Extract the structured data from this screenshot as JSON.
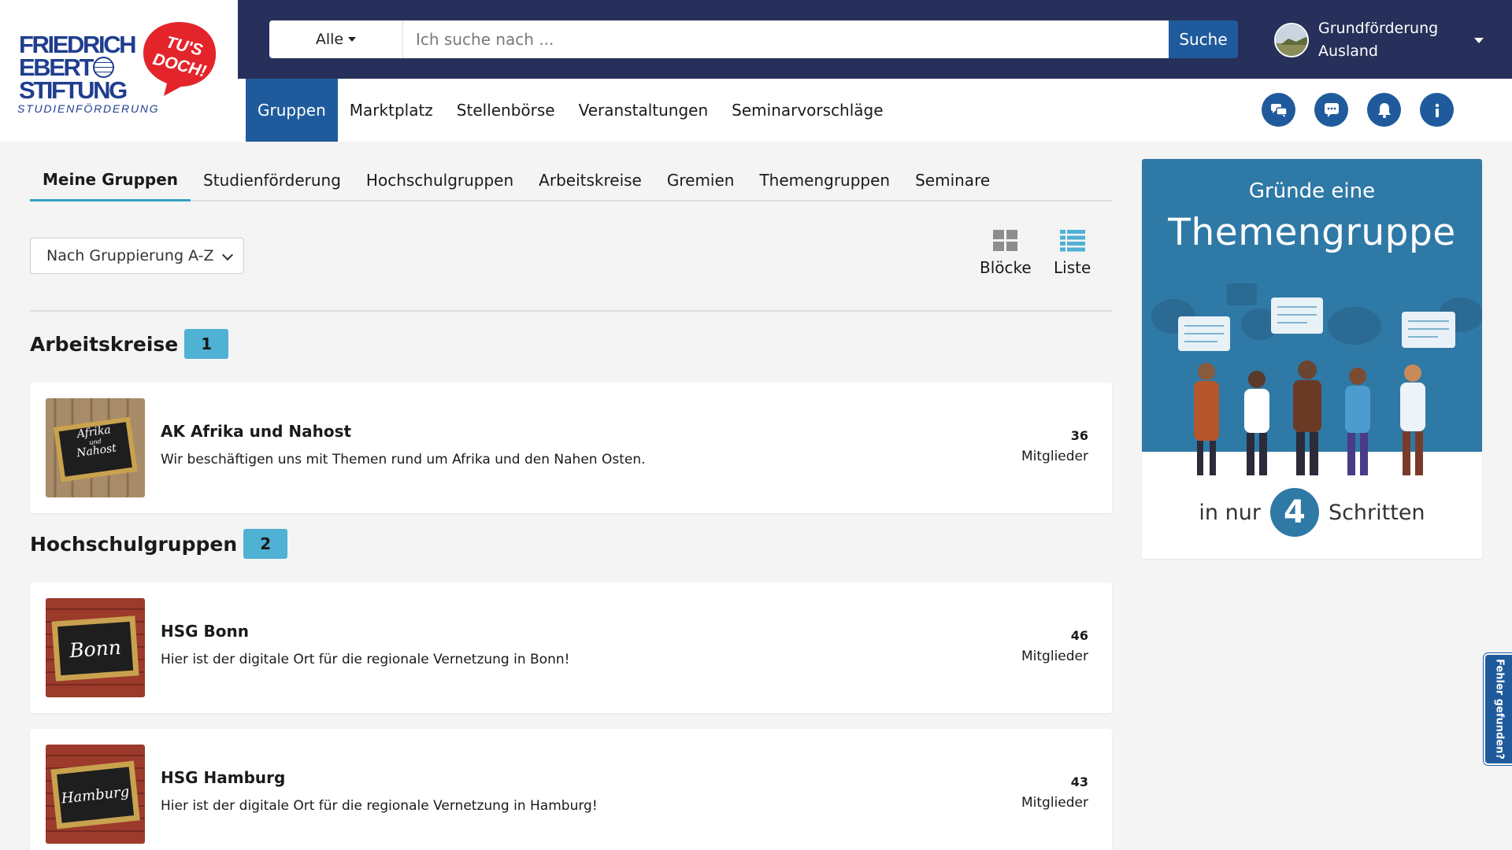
{
  "logo": {
    "lines": [
      "FRIEDRICH",
      "EBERT",
      "STIFTUNG"
    ],
    "subtitle": "STUDIENFÖRDERUNG",
    "bubble_lines": [
      "TU'S",
      "DOCH!"
    ],
    "brand_color": "#1f3e8f",
    "bubble_color": "#e3252b"
  },
  "search": {
    "category": "Alle",
    "placeholder": "Ich suche nach ...",
    "value": "",
    "button_label": "Suche"
  },
  "user": {
    "name_line1": "Grundförderung",
    "name_line2": "Ausland"
  },
  "nav": {
    "items": [
      {
        "label": "Gruppen",
        "active": true
      },
      {
        "label": "Marktplatz"
      },
      {
        "label": "Stellenbörse"
      },
      {
        "label": "Veranstaltungen"
      },
      {
        "label": "Seminarvorschläge"
      }
    ],
    "icons": [
      "chat-icon",
      "message-icon",
      "bell-icon",
      "info-icon"
    ]
  },
  "tabs": [
    {
      "label": "Meine Gruppen",
      "active": true
    },
    {
      "label": "Studienförderung"
    },
    {
      "label": "Hochschulgruppen"
    },
    {
      "label": "Arbeitskreise"
    },
    {
      "label": "Gremien"
    },
    {
      "label": "Themengruppen"
    },
    {
      "label": "Seminare"
    }
  ],
  "sort": {
    "selected": "Nach Gruppierung A-Z",
    "options": [
      "Nach Gruppierung A-Z"
    ]
  },
  "views": {
    "blocks_label": "Blöcke",
    "list_label": "Liste",
    "active": "list"
  },
  "sections": [
    {
      "title": "Arbeitskreise",
      "count": "1",
      "groups": [
        {
          "title": "AK Afrika und Nahost",
          "description": "Wir beschäftigen uns mit Themen rund um Afrika und den Nahen Osten.",
          "members": "36",
          "members_label": "Mitglieder",
          "board_lines": [
            "Afrika",
            "und",
            "Nahost"
          ],
          "bg": "wood"
        }
      ]
    },
    {
      "title": "Hochschulgruppen",
      "count": "2",
      "groups": [
        {
          "title": "HSG Bonn",
          "description": "Hier ist der digitale Ort für die regionale Vernetzung in Bonn!",
          "members": "46",
          "members_label": "Mitglieder",
          "board_lines": [
            "Bonn"
          ],
          "bg": "brick"
        },
        {
          "title": "HSG Hamburg",
          "description": "Hier ist der digitale Ort für die regionale Vernetzung in Hamburg!",
          "members": "43",
          "members_label": "Mitglieder",
          "board_lines": [
            "Hamburg"
          ],
          "bg": "brick"
        }
      ]
    }
  ],
  "promo": {
    "line1": "Gründe eine",
    "line2": "Themengruppe",
    "pre": "in nur",
    "number": "4",
    "post": "Schritten"
  },
  "feedback": {
    "label": "Fehler gefunden?"
  },
  "colors": {
    "header": "#27305a",
    "primary": "#1f5b9c",
    "accent": "#4fb1d3",
    "promo": "#2f79a6"
  }
}
